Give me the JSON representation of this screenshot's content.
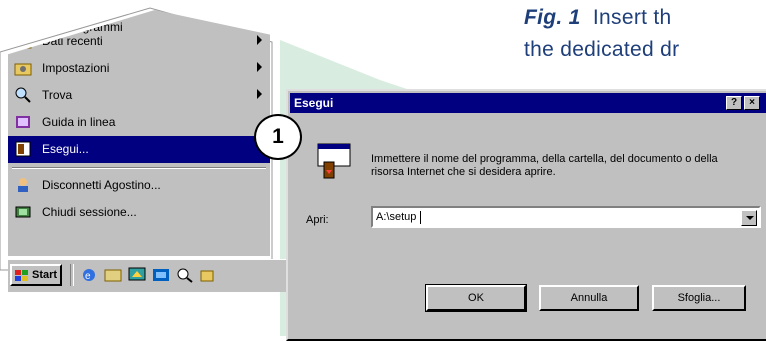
{
  "caption": {
    "fig_label": "Fig. 1",
    "line1_text": "Insert th",
    "line2_text": "the dedicated dr"
  },
  "start_menu": {
    "items": [
      {
        "label": "Dati recenti",
        "icon": "documents-folder-icon",
        "submenu": true
      },
      {
        "label": "Impostazioni",
        "icon": "settings-folder-icon",
        "submenu": true
      },
      {
        "label": "Trova",
        "icon": "find-icon",
        "submenu": true
      },
      {
        "label": "Guida in linea",
        "icon": "help-book-icon",
        "submenu": false
      },
      {
        "label": "Esegui...",
        "icon": "run-icon",
        "submenu": false,
        "selected": true
      },
      {
        "label": "Disconnetti Agostino...",
        "icon": "logoff-icon",
        "submenu": false
      },
      {
        "label": "Chiudi sessione...",
        "icon": "shutdown-icon",
        "submenu": false
      }
    ],
    "top_partial_label": "Programmi"
  },
  "taskbar": {
    "start_label": "Start"
  },
  "dialog": {
    "title": "Esegui",
    "help_label": "?",
    "close_label": "×",
    "message": "Immettere il nome del programma, della cartella, del documento o della risorsa Internet che si desidera aprire.",
    "open_label": "Apri:",
    "open_value": "A:\\setup",
    "buttons": {
      "ok": "OK",
      "cancel": "Annulla",
      "browse": "Sfoglia..."
    }
  },
  "callout": {
    "number": "1"
  },
  "colors": {
    "title_bar": "#000080",
    "window_face": "#c0c0c0",
    "caption_text": "#1f3f7a",
    "backdrop_green": "#cfe5d6"
  }
}
